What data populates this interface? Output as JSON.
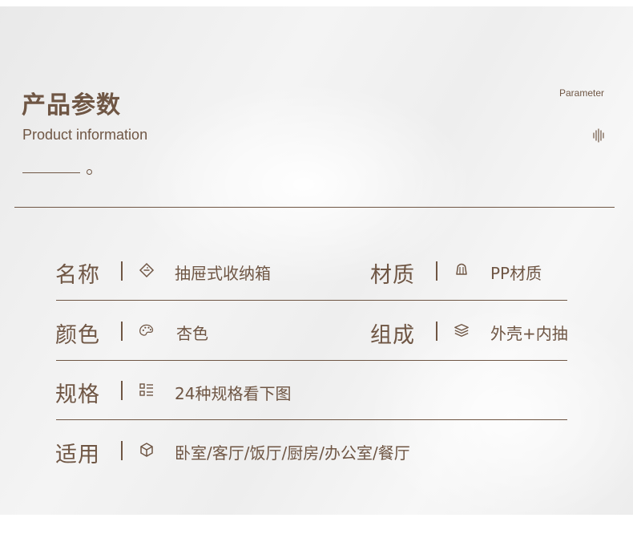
{
  "header": {
    "title_cn": "产品参数",
    "title_en": "Product information",
    "tag_en": "Parameter"
  },
  "colors": {
    "text": "#6f5644",
    "line": "#6f5644"
  },
  "params": {
    "name": {
      "label": "名称",
      "value": "抽屉式收纳箱",
      "icon": "tag-diamond-icon"
    },
    "material": {
      "label": "材质",
      "value": "PP材质",
      "icon": "bell-icon"
    },
    "color": {
      "label": "颜色",
      "value": "杏色",
      "icon": "palette-icon"
    },
    "composition": {
      "label": "组成",
      "value": "外壳+内抽",
      "icon": "layers-icon"
    },
    "spec": {
      "label": "规格",
      "value": "24种规格看下图",
      "icon": "list-icon"
    },
    "usage": {
      "label": "适用",
      "value": "卧室/客厅/饭厅/厨房/办公室/餐厅",
      "icon": "box-icon"
    }
  }
}
